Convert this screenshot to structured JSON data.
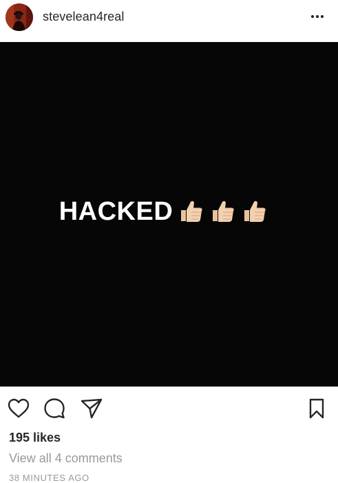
{
  "post": {
    "username": "stevelean4real",
    "image_text": "HACKED",
    "thumbs_count": 3,
    "likes": "195 likes",
    "comments_link": "View all 4 comments",
    "timestamp": "38 MINUTES AGO"
  },
  "icons": {
    "more": "more-options-icon",
    "like": "heart-icon",
    "comment": "comment-bubble-icon",
    "share": "paper-plane-icon",
    "save": "bookmark-icon",
    "emoji": "thumbs-up-emoji"
  },
  "colors": {
    "text": "#262626",
    "muted": "#999999",
    "photo_bg": "#060606",
    "thumb_skin": "#f2d1b0"
  }
}
